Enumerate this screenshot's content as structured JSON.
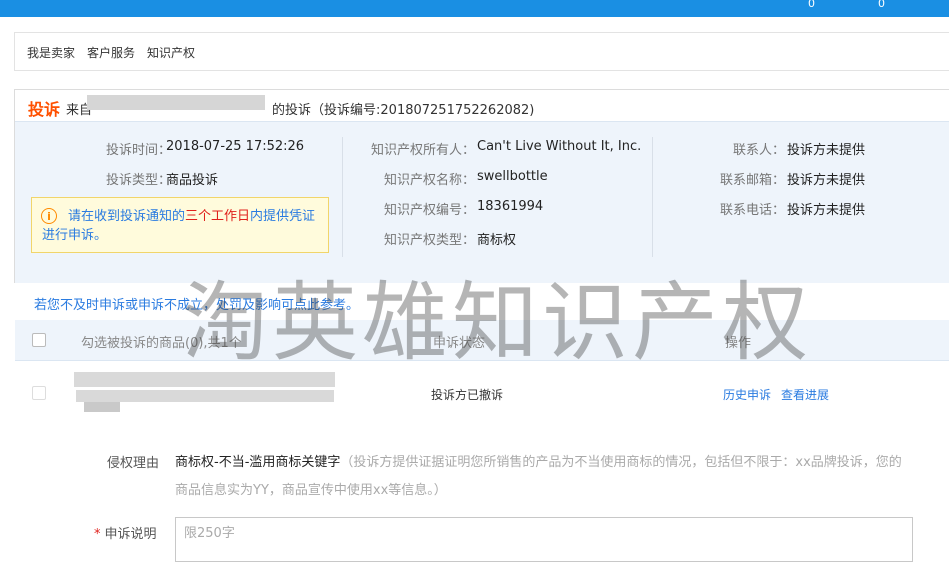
{
  "topbar": {
    "count1": "0",
    "count2": "0"
  },
  "breadcrumb": [
    "我是卖家",
    "客户服务",
    "知识产权"
  ],
  "complaint": {
    "title": "投诉",
    "from_prefix": "来自",
    "from_suffix": "的投诉（投诉编号:201807251752262082)",
    "time_label": "投诉时间：",
    "time_value": "2018-07-25 17:52:26",
    "type_label": "投诉类型：",
    "type_value": "商品投诉",
    "warning_pre": "请在收到投诉通知的",
    "warning_emph": "三个工作日",
    "warning_post": "内提供凭证进行申诉。",
    "ip_owner_label": "知识产权所有人：",
    "ip_owner_value": "Can't Live Without It, Inc.",
    "ip_name_label": "知识产权名称：",
    "ip_name_value": "swellbottle",
    "ip_no_label": "知识产权编号：",
    "ip_no_value": "18361994",
    "ip_type_label": "知识产权类型：",
    "ip_type_value": "商标权",
    "contact_label": "联系人：",
    "contact_value": "投诉方未提供",
    "email_label": "联系邮箱：",
    "email_value": "投诉方未提供",
    "phone_label": "联系电话：",
    "phone_value": "投诉方未提供"
  },
  "notice": "若您不及时申诉或申诉不成立，处罚及影响可点此参考。",
  "table": {
    "col_goods": "勾选被投诉的商品(0),共1个",
    "col_status": "申诉状态",
    "col_action": "操作",
    "rows": [
      {
        "status": "投诉方已撤诉",
        "action1": "历史申诉",
        "action2": "查看进展"
      }
    ]
  },
  "reason": {
    "label": "侵权理由",
    "main": "商标权-不当-滥用商标关键字",
    "detail": "（投诉方提供证据证明您所销售的产品为不当使用商标的情况，包括但不限于：xx品牌投诉，您的商品信息实为YY，商品宣传中使用xx等信息。）"
  },
  "appeal": {
    "required_mark": "*",
    "label": "申诉说明",
    "placeholder": "限250字"
  },
  "watermark": "淘英雄知识产权",
  "colors": {
    "topbar": "#1a8fe3",
    "accent": "#ff5000",
    "link": "#2a7be0",
    "warning_emph": "#e0201b"
  }
}
